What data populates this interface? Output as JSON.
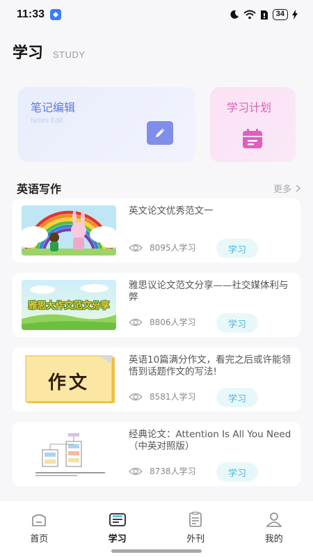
{
  "status_bar": {
    "time": "11:33",
    "battery": "34"
  },
  "header": {
    "title": "学习",
    "subtitle": "STUDY"
  },
  "cards": {
    "notes": {
      "title": "笔记编辑",
      "subtitle": "Notes Edit",
      "icon": "pencil-icon",
      "color": "#7f8ee8"
    },
    "plan": {
      "title": "学习计划",
      "icon": "calendar-icon",
      "color": "#e35cbf"
    }
  },
  "section": {
    "title": "英语写作",
    "more": "更多"
  },
  "articles": [
    {
      "title": "英文论文优秀范文一",
      "readers": "8095人学习",
      "button": "学习",
      "thumbnail": "rainbow-bunny-image"
    },
    {
      "title": "雅思议论文范文分享——社交媒体利与弊",
      "readers": "8806人学习",
      "button": "学习",
      "thumbnail": "ielts-banner-image",
      "thumb_text": "雅思大作文范文分享"
    },
    {
      "title": "英语10篇满分作文，看完之后或许能领悟到话题作文的写法!",
      "readers": "8581人学习",
      "button": "学习",
      "thumbnail": "essay-paper-image",
      "thumb_text": "作文"
    },
    {
      "title": "经典论文：Attention Is All You Need（中英对照版）",
      "readers": "8738人学习",
      "button": "学习",
      "thumbnail": "transformer-diagram-image"
    }
  ],
  "bottom_nav": [
    {
      "label": "首页",
      "icon": "home-icon",
      "active": false
    },
    {
      "label": "学习",
      "icon": "study-icon",
      "active": true
    },
    {
      "label": "外刊",
      "icon": "clipboard-icon",
      "active": false
    },
    {
      "label": "我的",
      "icon": "profile-icon",
      "active": false
    }
  ],
  "colors": {
    "accent_blue": "#5c7ae0",
    "accent_pink": "#d960b6",
    "study_button_bg": "#e8f7fa",
    "study_button_text": "#4bb6d4"
  }
}
